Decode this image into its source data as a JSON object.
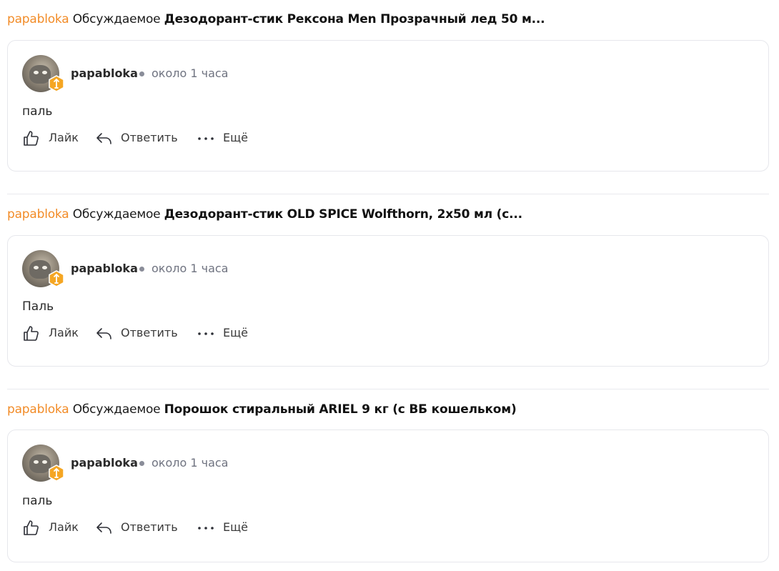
{
  "colors": {
    "accent": "#f28c28",
    "badge": "#f5a623",
    "muted": "#6f7380",
    "border": "#e6e7ec"
  },
  "icons": {
    "like": "thumbs-up-icon",
    "reply": "reply-arrow-icon",
    "more": "ellipsis-icon",
    "badge": "shield-badge-icon"
  },
  "entries": [
    {
      "author": "papabloka",
      "verb": "Обсуждаемое",
      "topic": "Дезодорант-стик Рексона Men Прозрачный лед 50 м...",
      "card": {
        "username": "papabloka",
        "time": "около 1 часа",
        "text": "паль",
        "actions": {
          "like": "Лайк",
          "reply": "Ответить",
          "more": "Ещё"
        }
      }
    },
    {
      "author": "papabloka",
      "verb": "Обсуждаемое",
      "topic": "Дезодорант-стик OLD SPICE Wolfthorn, 2х50 мл (с...",
      "card": {
        "username": "papabloka",
        "time": "около 1 часа",
        "text": "Паль",
        "actions": {
          "like": "Лайк",
          "reply": "Ответить",
          "more": "Ещё"
        }
      }
    },
    {
      "author": "papabloka",
      "verb": "Обсуждаемое",
      "topic": "Порошок стиральный ARIEL 9 кг (с ВБ кошельком)",
      "card": {
        "username": "papabloka",
        "time": "около 1 часа",
        "text": "паль",
        "actions": {
          "like": "Лайк",
          "reply": "Ответить",
          "more": "Ещё"
        }
      }
    }
  ]
}
